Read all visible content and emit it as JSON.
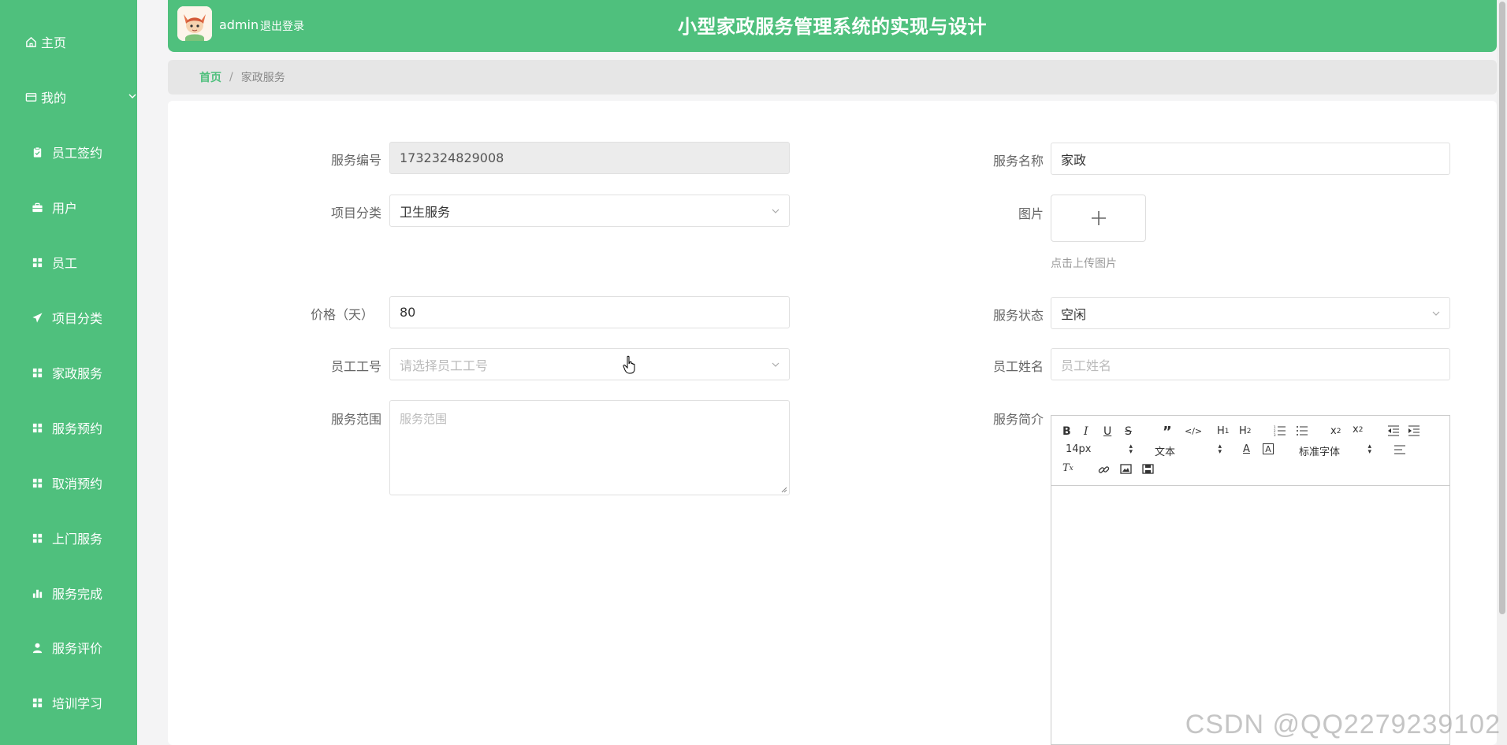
{
  "sidebar": {
    "items": [
      {
        "label": "主页",
        "icon": "home-icon"
      },
      {
        "label": "我的",
        "icon": "card-icon"
      },
      {
        "label": "员工签约",
        "icon": "clipboard-icon"
      },
      {
        "label": "用户",
        "icon": "briefcase-icon"
      },
      {
        "label": "员工",
        "icon": "grid-icon"
      },
      {
        "label": "项目分类",
        "icon": "send-icon"
      },
      {
        "label": "家政服务",
        "icon": "grid-icon"
      },
      {
        "label": "服务预约",
        "icon": "grid-icon"
      },
      {
        "label": "取消预约",
        "icon": "grid-icon"
      },
      {
        "label": "上门服务",
        "icon": "grid-icon"
      },
      {
        "label": "服务完成",
        "icon": "bar-chart-icon"
      },
      {
        "label": "服务评价",
        "icon": "user-icon"
      },
      {
        "label": "培训学习",
        "icon": "grid-icon"
      }
    ]
  },
  "header": {
    "user": "admin",
    "logout": "退出登录",
    "title": "小型家政服务管理系统的实现与设计"
  },
  "breadcrumb": {
    "home": "首页",
    "sep": "/",
    "current": "家政服务"
  },
  "form": {
    "service_no": {
      "label": "服务编号",
      "value": "1732324829008"
    },
    "service_name": {
      "label": "服务名称",
      "value": "家政"
    },
    "category": {
      "label": "项目分类",
      "value": "卫生服务"
    },
    "image": {
      "label": "图片",
      "tip": "点击上传图片"
    },
    "price": {
      "label": "价格（天）",
      "value": "80"
    },
    "status": {
      "label": "服务状态",
      "value": "空闲"
    },
    "staff_no": {
      "label": "员工工号",
      "placeholder": "请选择员工工号"
    },
    "staff_name": {
      "label": "员工姓名",
      "placeholder": "员工姓名"
    },
    "scope": {
      "label": "服务范围",
      "placeholder": "服务范围"
    },
    "intro": {
      "label": "服务简介"
    }
  },
  "editor": {
    "font_size": "14px",
    "block_type": "文本",
    "font_family": "标准字体",
    "buttons": [
      "bold",
      "italic",
      "underline",
      "strike",
      "blockquote",
      "code",
      "h1",
      "h2",
      "ordered-list",
      "bullet-list",
      "subscript",
      "superscript",
      "outdent",
      "indent",
      "align",
      "clear-format",
      "link",
      "image",
      "video"
    ]
  },
  "watermark": "CSDN @QQ2279239102",
  "colors": {
    "primary": "#4fc07d",
    "panel": "#ffffff",
    "breadcrumb": "#e6e6e6"
  }
}
